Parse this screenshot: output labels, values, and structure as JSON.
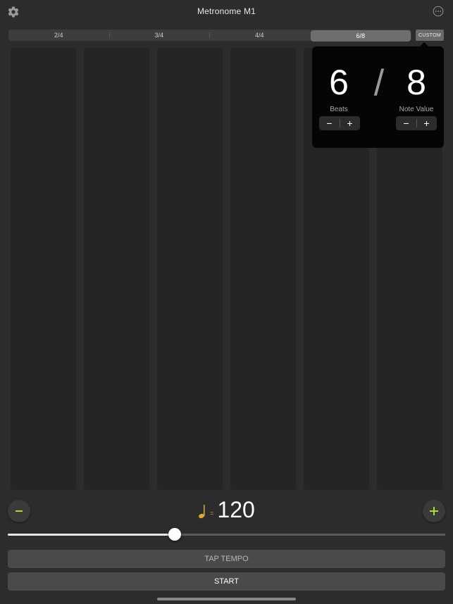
{
  "header": {
    "title": "Metronome M1",
    "settings_icon": "gear-icon",
    "more_icon": "ellipsis-circle-icon"
  },
  "time_signatures": {
    "options": [
      {
        "label": "2/4",
        "selected": false
      },
      {
        "label": "3/4",
        "selected": false
      },
      {
        "label": "4/4",
        "selected": false
      },
      {
        "label": "6/8",
        "selected": true
      }
    ],
    "custom_label": "CUSTOM"
  },
  "beats": {
    "count": 6
  },
  "popover": {
    "beats_value": "6",
    "slash": "/",
    "note_value": "8",
    "beats_label": "Beats",
    "note_value_label": "Note Value",
    "minus_glyph": "−",
    "plus_glyph": "+"
  },
  "tempo": {
    "equals": "=",
    "bpm": "120",
    "slider_fraction": 0.381
  },
  "actions": {
    "tap_tempo_label": "TAP TEMPO",
    "start_label": "START"
  },
  "colors": {
    "accent_green": "#a8d93a",
    "note_gold": "#d9a93a",
    "background": "#2c2c2c"
  }
}
